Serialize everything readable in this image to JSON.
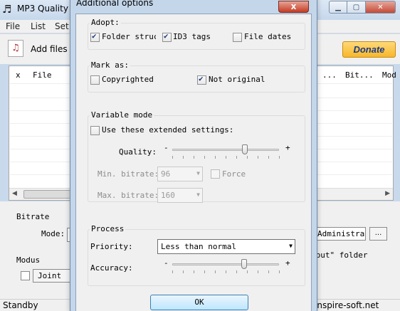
{
  "main": {
    "title": "MP3 Quality",
    "menu": [
      "File",
      "List",
      "Set"
    ],
    "toolbar": {
      "add_files": "Add files",
      "donate": "Donate"
    },
    "columns": [
      "x",
      "File",
      "...",
      "Bit...",
      "Mod"
    ],
    "bitrate_label": "Bitrate",
    "mode_label": "Mode:",
    "modus_label": "Modus",
    "joint_stereo": "Joint St",
    "output_path": "Administrat",
    "browse": "...",
    "output_folder_text": "tput\" folder",
    "status_left": "Standby",
    "status_right": "inspire-soft.net"
  },
  "dialog": {
    "title": "Additional options",
    "close": "x",
    "adopt": {
      "legend": "Adopt:",
      "folder_structure": {
        "label": "Folder struc",
        "checked": true
      },
      "id3_tags": {
        "label": "ID3 tags",
        "checked": true
      },
      "file_dates": {
        "label": "File dates",
        "checked": false
      }
    },
    "mark_as": {
      "legend": "Mark as:",
      "copyrighted": {
        "label": "Copyrighted",
        "checked": false
      },
      "not_original": {
        "label": "Not original",
        "checked": true
      }
    },
    "variable_mode": {
      "legend": "Variable mode",
      "use_extended": {
        "label": "Use these extended settings:",
        "checked": false
      },
      "quality_label": "Quality:",
      "quality_level": 0.68,
      "minus": "-",
      "plus": "+",
      "min_bitrate_label": "Min. bitrate:",
      "min_bitrate": "96",
      "force": {
        "label": "Force",
        "checked": false
      },
      "max_bitrate_label": "Max. bitrate:",
      "max_bitrate": "160"
    },
    "process": {
      "legend": "Process",
      "priority_label": "Priority:",
      "priority": "Less than normal",
      "accuracy_label": "Accuracy:",
      "accuracy_level": 0.67,
      "minus": "-",
      "plus": "+"
    },
    "ok": "OK"
  }
}
